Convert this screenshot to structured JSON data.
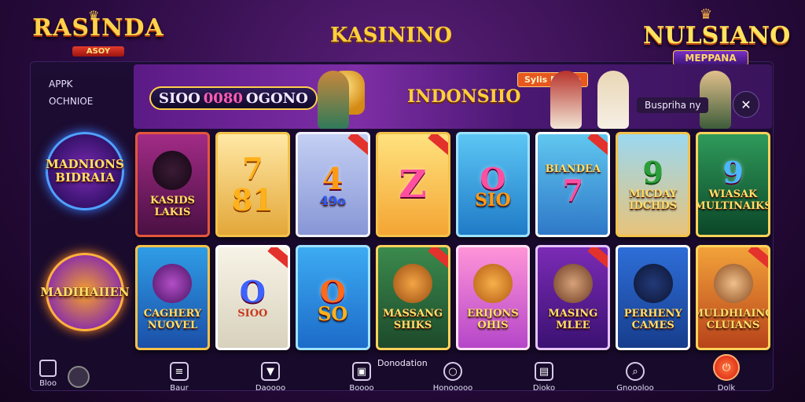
{
  "logo_left": {
    "title": "RASINDA",
    "ribbon": "ASOY"
  },
  "logo_right": {
    "title": "NULSIANO",
    "ribbon": "MEPPANA"
  },
  "app_title": "KASININO",
  "sidebar": {
    "line1": "APPK",
    "line2": "OCHNIOE",
    "badge1": "MADNIONS BIDRAIA",
    "badge2": "MADIHAIIEN"
  },
  "banner": {
    "jackpot_prefix": "SIOO",
    "jackpot_value": "0080",
    "jackpot_suffix": "OGONO",
    "title": "INDONSIIO",
    "tag": "Sylis Ruilda",
    "chip": "Buspriha ny",
    "action_icon": "tools-icon"
  },
  "tiles": [
    {
      "big": "",
      "label": "KASIDS LAKIS"
    },
    {
      "big": "7 81",
      "label": ""
    },
    {
      "big": "4",
      "label": "49o"
    },
    {
      "big": "Z",
      "label": ""
    },
    {
      "big": "O",
      "label": "SIO"
    },
    {
      "big": "7",
      "label": "BIANDEA"
    },
    {
      "big": "9",
      "label": "MICDAY IDCHDS"
    },
    {
      "big": "9",
      "label": "WIASAK MULTINAIKS"
    },
    {
      "big": "",
      "label": "CAGHERY NUOVEL"
    },
    {
      "big": "O",
      "label": "SIOO"
    },
    {
      "big": "O",
      "label": "SO"
    },
    {
      "big": "",
      "label": "MASSANG SHIKS"
    },
    {
      "big": "",
      "label": "ERIJONS OHIS"
    },
    {
      "big": "",
      "label": "MASING MLEE"
    },
    {
      "big": "",
      "label": "PERHENY CAMES"
    },
    {
      "big": "",
      "label": "MULDHIAING CLUIANS"
    }
  ],
  "bottom_nav": {
    "caption": "Donodation",
    "left_items": [
      "Bloo",
      ""
    ],
    "items": [
      "Baur",
      "Daoooo",
      "Boooo",
      "Honooooo",
      "Dioko",
      "Gnoooloo",
      "Dolk"
    ]
  }
}
